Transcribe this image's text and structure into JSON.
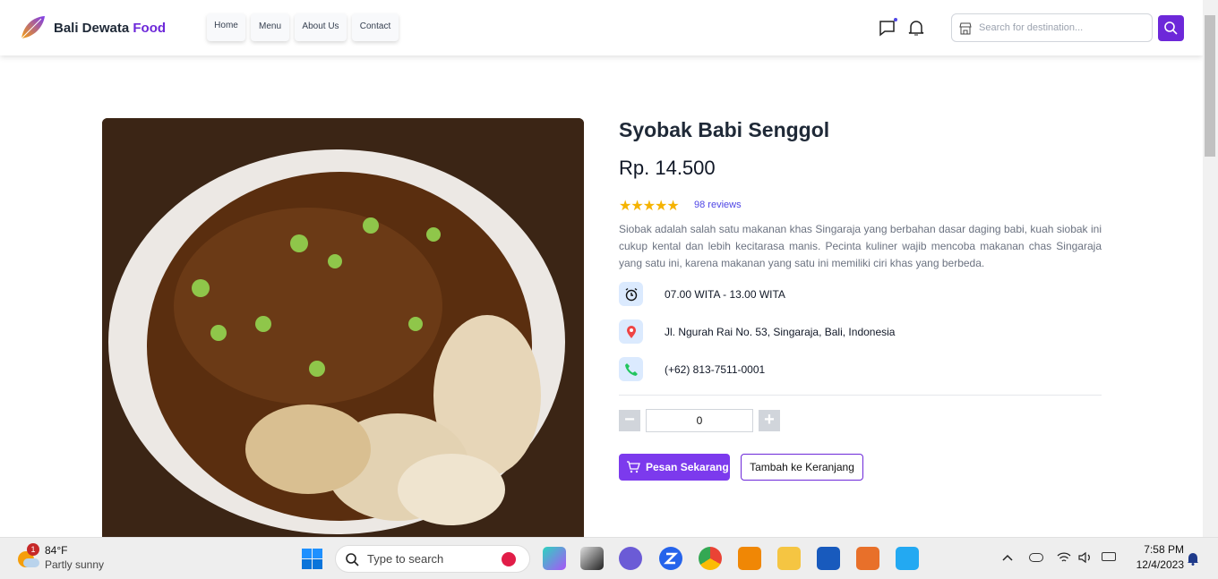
{
  "header": {
    "brand_main": "Bali Dewata",
    "brand_accent": "Food",
    "nav": [
      "Home",
      "Menu",
      "About Us",
      "Contact"
    ],
    "search_placeholder": "Search for destination..."
  },
  "product": {
    "name": "Syobak Babi Senggol",
    "price": "Rp. 14.500",
    "rating": 5,
    "stars": "★★★★★",
    "reviews": "98 reviews",
    "description": "Siobak adalah salah satu makanan khas Singaraja yang berbahan dasar daging babi, kuah siobak ini cukup kental dan lebih kecitarasa manis. Pecinta kuliner wajib mencoba makanan chas Singaraja yang satu ini, karena makanan yang satu ini memiliki ciri khas yang berbeda.",
    "hours": "07.00 WITA - 13.00 WITA",
    "address": "Jl. Ngurah Rai No. 53, Singaraja, Bali, Indonesia",
    "phone": "(+62) 813-7511-0001",
    "quantity": "0",
    "minus": "−",
    "plus": "+",
    "buy_label": "Pesan Sekarang",
    "cart_label": "Tambah ke Keranjang"
  },
  "taskbar": {
    "weather_temp": "84°F",
    "weather_desc": "Partly sunny",
    "weather_badge": "1",
    "search_placeholder": "Type to search",
    "time": "7:58 PM",
    "date": "12/4/2023"
  },
  "colors": {
    "accent": "#6d28d9",
    "button": "#7c3aed",
    "star": "#f5b301"
  }
}
